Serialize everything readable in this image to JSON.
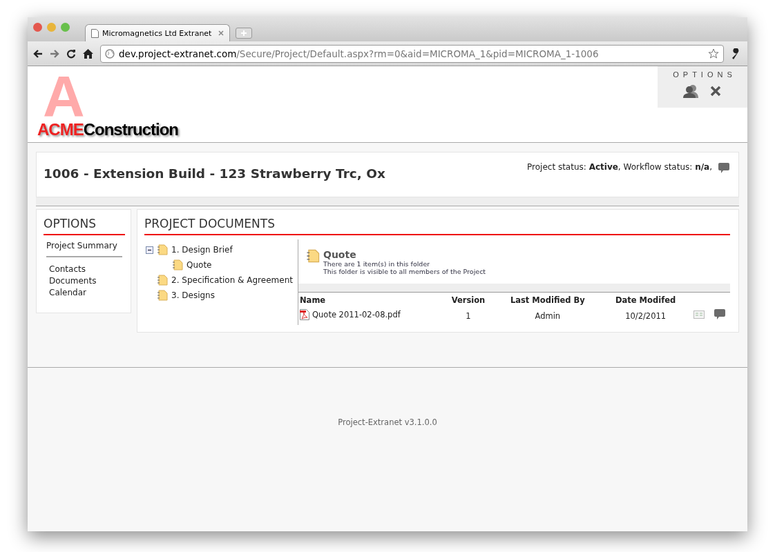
{
  "browser": {
    "tab_title": "Micromagnetics Ltd Extranet",
    "url_host": "dev.project-extranet.com",
    "url_path": "/Secure/Project/Default.aspx?rm=0&aid=MICROMA_1&pid=MICROMA_1-1006"
  },
  "logo": {
    "letter": "A",
    "brand": "ACME",
    "name": "Construction"
  },
  "options_box": {
    "title": "OPTIONS"
  },
  "project": {
    "title": "1006 - Extension Build - 123 Strawberry Trc, Ox",
    "status": "Project status: **Active**, Workflow status: **n/a**,"
  },
  "sidebar": {
    "title": "OPTIONS",
    "groups": [
      [
        "Project Summary"
      ],
      [
        "Contacts",
        "Documents",
        "Calendar"
      ]
    ]
  },
  "documents": {
    "title": "PROJECT DOCUMENTS",
    "tree": [
      {
        "label": "1. Design Brief",
        "expanded": true,
        "children": [
          {
            "label": "Quote",
            "expanded": false
          }
        ]
      },
      {
        "label": "2. Specification & Agreement",
        "expanded": false
      },
      {
        "label": "3. Designs",
        "expanded": false
      }
    ],
    "folder": {
      "name": "Quote",
      "lines": [
        "There are 1 item(s) in this folder",
        "This folder is visible to all members of the Project"
      ]
    },
    "table": {
      "columns": [
        "Name",
        "Version",
        "Last Modified By",
        "Date Modifed"
      ],
      "rows": [
        {
          "cells": [
            "Quote 2011-02-08.pdf",
            "1",
            "Admin",
            "10/2/2011"
          ]
        }
      ]
    }
  },
  "footer": {
    "version": "Project-Extranet v3.1.0.0"
  }
}
